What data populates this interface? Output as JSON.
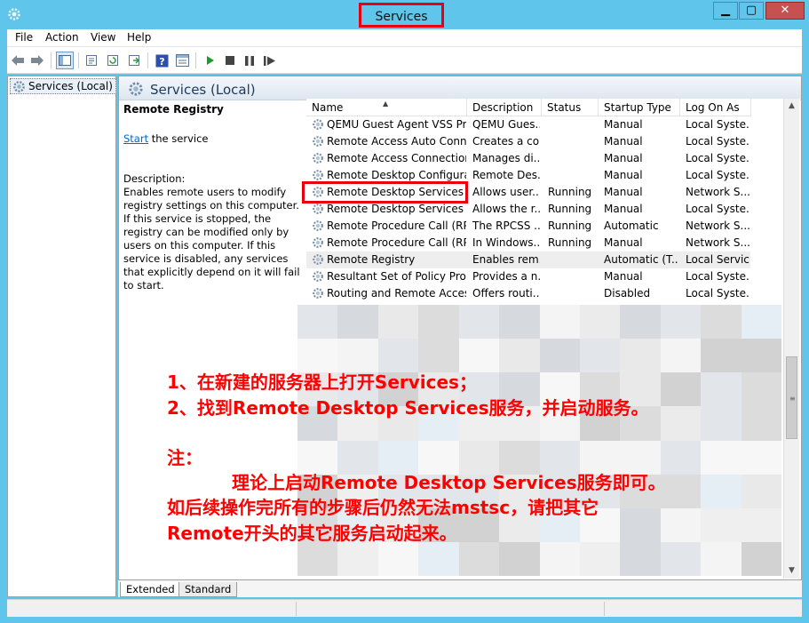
{
  "window": {
    "title": "Services",
    "controls": {
      "minimize": "▁",
      "maximize": "▢",
      "close": "✕"
    }
  },
  "menu": [
    "File",
    "Action",
    "View",
    "Help"
  ],
  "tree": {
    "root_label": "Services (Local)"
  },
  "main": {
    "header_title": "Services (Local)",
    "detail": {
      "service_name": "Remote Registry",
      "start_link": "Start",
      "start_suffix": " the service",
      "description_label": "Description:",
      "description_text": "Enables remote users to modify registry settings on this computer. If this service is stopped, the registry can be modified only by users on this computer. If this service is disabled, any services that explicitly depend on it will fail to start."
    }
  },
  "list": {
    "columns": [
      "Name",
      "Description",
      "Status",
      "Startup Type",
      "Log On As"
    ],
    "rows": [
      {
        "name": "QEMU Guest Agent VSS Pro...",
        "description": "QEMU Gues...",
        "status": "",
        "startup": "Manual",
        "logon": "Local Syste..."
      },
      {
        "name": "Remote Access Auto Conne...",
        "description": "Creates a co...",
        "status": "",
        "startup": "Manual",
        "logon": "Local Syste..."
      },
      {
        "name": "Remote Access Connection...",
        "description": "Manages di...",
        "status": "",
        "startup": "Manual",
        "logon": "Local Syste..."
      },
      {
        "name": "Remote Desktop Configurat...",
        "description": "Remote Des...",
        "status": "",
        "startup": "Manual",
        "logon": "Local Syste..."
      },
      {
        "name": "Remote Desktop Services",
        "description": "Allows user...",
        "status": "Running",
        "startup": "Manual",
        "logon": "Network S..."
      },
      {
        "name": "Remote Desktop Services U...",
        "description": "Allows the r...",
        "status": "Running",
        "startup": "Manual",
        "logon": "Local Syste..."
      },
      {
        "name": "Remote Procedure Call (RPC)",
        "description": "The RPCSS ...",
        "status": "Running",
        "startup": "Automatic",
        "logon": "Network S..."
      },
      {
        "name": "Remote Procedure Call (RP...",
        "description": "In Windows...",
        "status": "Running",
        "startup": "Manual",
        "logon": "Network S..."
      },
      {
        "name": "Remote Registry",
        "description": "Enables rem...",
        "status": "",
        "startup": "Automatic (T...",
        "logon": "Local Service"
      },
      {
        "name": "Resultant Set of Policy Provi...",
        "description": "Provides a n...",
        "status": "",
        "startup": "Manual",
        "logon": "Local Syste..."
      },
      {
        "name": "Routing and Remote Access",
        "description": "Offers routi...",
        "status": "",
        "startup": "Disabled",
        "logon": "Local Syste..."
      }
    ]
  },
  "annotation": {
    "line1": "1、在新建的服务器上打开Services；",
    "line2": "2、找到Remote Desktop Services服务，并启动服务。",
    "line3": "注：",
    "line4": "理论上启动Remote Desktop Services服务即可。",
    "line5": "如后续操作完所有的步骤后仍然无法mstsc，请把其它",
    "line6": "Remote开头的其它服务启动起来。"
  },
  "tabs": [
    "Extended",
    "Standard"
  ],
  "colors": {
    "titlebar": "#5fc5ea",
    "highlight_box": "#e8000c",
    "annotation": "#ff0000",
    "link": "#0066cc"
  }
}
